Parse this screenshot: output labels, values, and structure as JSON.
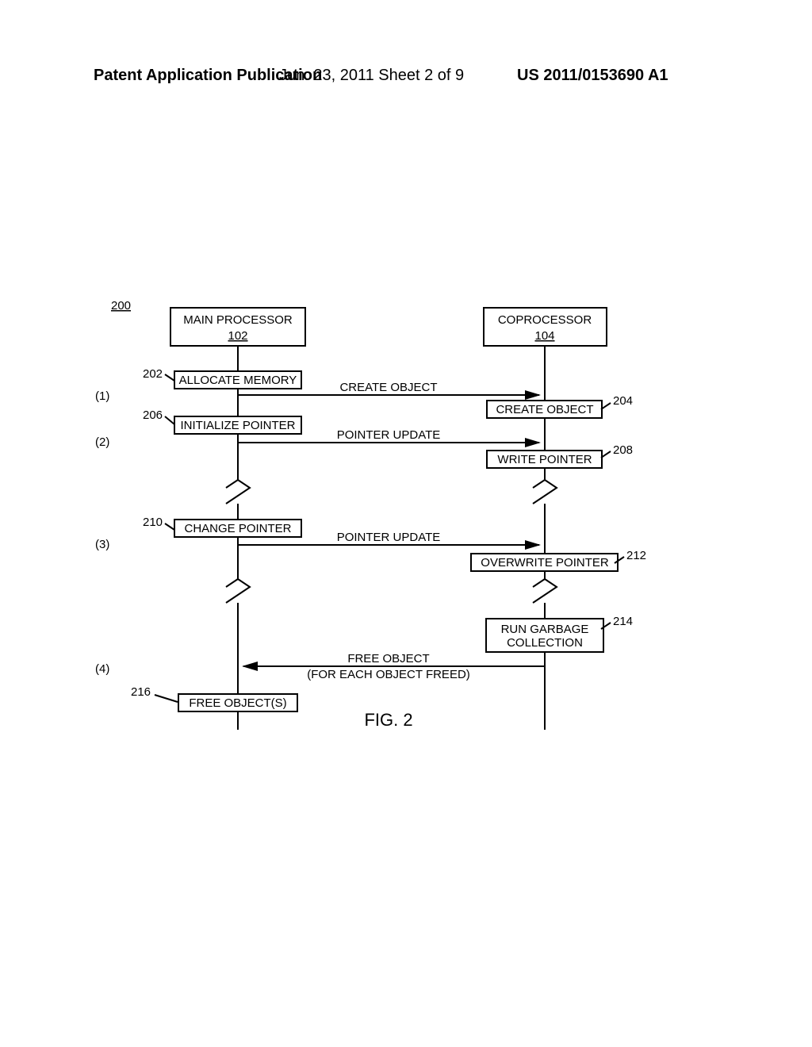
{
  "header": {
    "left": "Patent Application Publication",
    "mid": "Jun. 23, 2011  Sheet 2 of 9",
    "right": "US 2011/0153690 A1"
  },
  "diagram": {
    "caption": "FIG. 2",
    "id_label": "200",
    "left_actor": {
      "title": "MAIN PROCESSOR",
      "number": "102"
    },
    "right_actor": {
      "title": "COPROCESSOR",
      "number": "104"
    },
    "steps": {
      "s1": "(1)",
      "s2": "(2)",
      "s3": "(3)",
      "s4": "(4)"
    },
    "refs": {
      "r202": "202",
      "r204": "204",
      "r206": "206",
      "r208": "208",
      "r210": "210",
      "r212": "212",
      "r214": "214",
      "r216": "216"
    },
    "texts": {
      "allocate_memory": "ALLOCATE MEMORY",
      "create_object_msg": "CREATE OBJECT",
      "create_object_box": "CREATE OBJECT",
      "initialize_pointer": "INITIALIZE POINTER",
      "pointer_update1": "POINTER UPDATE",
      "write_pointer": "WRITE POINTER",
      "change_pointer": "CHANGE POINTER",
      "pointer_update2": "POINTER UPDATE",
      "overwrite_pointer": "OVERWRITE POINTER",
      "run_gc1": "RUN GARBAGE",
      "run_gc2": "COLLECTION",
      "free_object_msg": "FREE OBJECT",
      "free_object_sub": "(FOR EACH OBJECT FREED)",
      "free_objects_box": "FREE OBJECT(S)"
    }
  }
}
